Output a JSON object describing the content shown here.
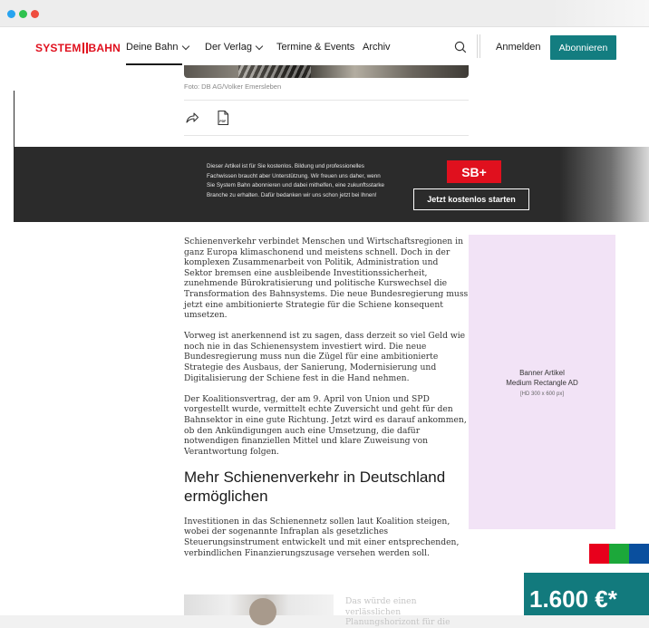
{
  "brand": {
    "part1": "SYSTEM",
    "part2": "BAHN",
    "color": "#e0101e"
  },
  "nav": {
    "items": [
      {
        "label": "Deine Bahn",
        "has_chevron": true,
        "active": true
      },
      {
        "label": "Der Verlag",
        "has_chevron": true,
        "active": false
      },
      {
        "label": "Termine & Events",
        "has_chevron": false,
        "active": false
      },
      {
        "label": "Archiv",
        "has_chevron": false,
        "active": false
      }
    ],
    "search_icon": "search-icon",
    "login_label": "Anmelden",
    "subscribe_label": "Abonnieren",
    "subscribe_color": "#137d80"
  },
  "image": {
    "caption": "Foto: DB AG/Volker Emersleben"
  },
  "actions": {
    "share_icon": "share-icon",
    "pdf_icon": "pdf-icon"
  },
  "promo": {
    "text": "Dieser Artikel ist für Sie kostenlos. Bildung und professionelles Fachwissen braucht aber Unterstützung. Wir freuen uns daher, wenn Sie System Bahn abonnieren und dabei mithelfen, eine zukunftsstarke Branche zu erhalten. Dafür bedanken wir uns schon jetzt bei Ihnen!",
    "badge": "SB+",
    "cta": "Jetzt kostenlos starten"
  },
  "article": {
    "p1": "Schienenverkehr verbindet Menschen und Wirtschaftsregionen in ganz Europa klimaschonend und meistens schnell. Doch in der komplexen Zusammenarbeit von Politik, Administration und Sektor bremsen eine ausbleibende Investitionssicherheit, zunehmende Bürokratisierung und politische Kurswechsel die Transformation des Bahnsystems. Die neue Bundesregierung muss jetzt eine ambitionierte Strategie für die Schiene konsequent umsetzen.",
    "p2": "Vorweg ist anerkennend ist zu sagen, dass derzeit so viel Geld wie noch nie in das Schienensystem investiert wird. Die neue Bundesregierung muss nun die Zügel für eine ambitionierte Strategie des Ausbaus, der Sanierung, Modernisierung und Digitalisierung der Schiene fest in die Hand nehmen.",
    "p3": "Der Koalitionsvertrag, der am 9. April von Union und SPD vorgestellt wurde, vermittelt echte Zuversicht und geht für den Bahnsektor in eine gute Richtung. Jetzt wird es darauf ankommen, ob den Ankündigungen auch eine Umsetzung, die dafür notwendigen finanziellen Mittel und klare Zuweisung von Verantwortung folgen.",
    "heading": "Mehr Schienenverkehr in Deutschland ermöglichen",
    "p4": "Investitionen in das Schienennetz sollen laut Koalition steigen, wobei der sogenannte Infraplan als gesetzliches Steuerungsinstrument entwickelt und mit einer entsprechenden, verbindlichen Finanzierungszusage versehen werden soll.",
    "p5": "Das würde einen verlässlichen Planungshorizont für die"
  },
  "ad": {
    "line1": "Banner Artikel",
    "line2": "Medium Rectangle AD",
    "line3": "[HD 300 x 600 px]",
    "background": "#f2e3f6"
  },
  "price_badge": {
    "text": "1.600 €*",
    "background": "#127a7d",
    "squares": [
      "#e8001c",
      "#1ca83a",
      "#0a4f9e"
    ]
  }
}
